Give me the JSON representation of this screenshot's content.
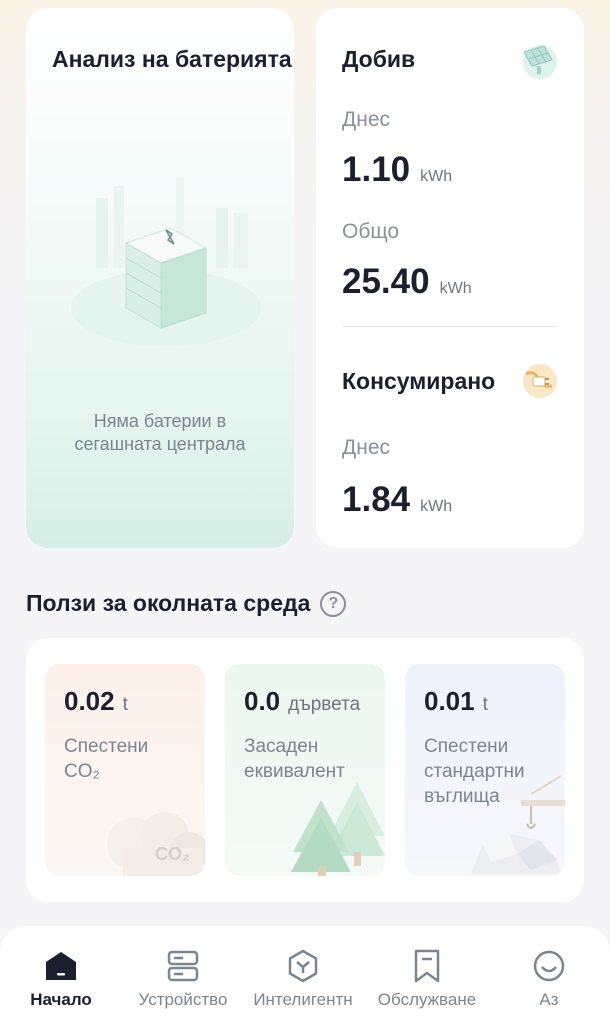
{
  "battery": {
    "title": "Анализ на батерията",
    "empty_line1": "Няма батерии в",
    "empty_line2": "сегашната централа"
  },
  "production": {
    "title": "Добив",
    "today_label": "Днес",
    "today_value": "1.10",
    "today_unit": "kWh",
    "total_label": "Общо",
    "total_value": "25.40",
    "total_unit": "kWh",
    "icon": "solar-panel-icon"
  },
  "consumption": {
    "title": "Консумирано",
    "today_label": "Днес",
    "today_value": "1.84",
    "today_unit": "kWh",
    "icon": "plug-icon"
  },
  "environment": {
    "title": "Ползи за околната среда",
    "help_glyph": "?",
    "tiles": [
      {
        "value": "0.02",
        "unit": "t",
        "label1": "Спестени",
        "label2": "CO₂",
        "label3": ""
      },
      {
        "value": "0.0",
        "unit": "дървета",
        "label1": "Засаден",
        "label2": "еквивалент",
        "label3": ""
      },
      {
        "value": "0.01",
        "unit": "t",
        "label1": "Спестени",
        "label2": "стандартни",
        "label3": "въглища"
      }
    ],
    "co2_cloud_text": "CO₂"
  },
  "nav": {
    "items": [
      {
        "label": "Начало",
        "icon": "home-icon",
        "active": true
      },
      {
        "label": "Устройство",
        "icon": "device-icon",
        "active": false
      },
      {
        "label": "Интелигентн",
        "icon": "smart-icon",
        "active": false
      },
      {
        "label": "Обслужване",
        "icon": "bookmark-icon",
        "active": false
      },
      {
        "label": "Аз",
        "icon": "smile-icon",
        "active": false
      }
    ]
  },
  "colors": {
    "accent_dark": "#1b1f2e",
    "muted": "#8a909c",
    "battery_gradient": "#d6efe7"
  }
}
